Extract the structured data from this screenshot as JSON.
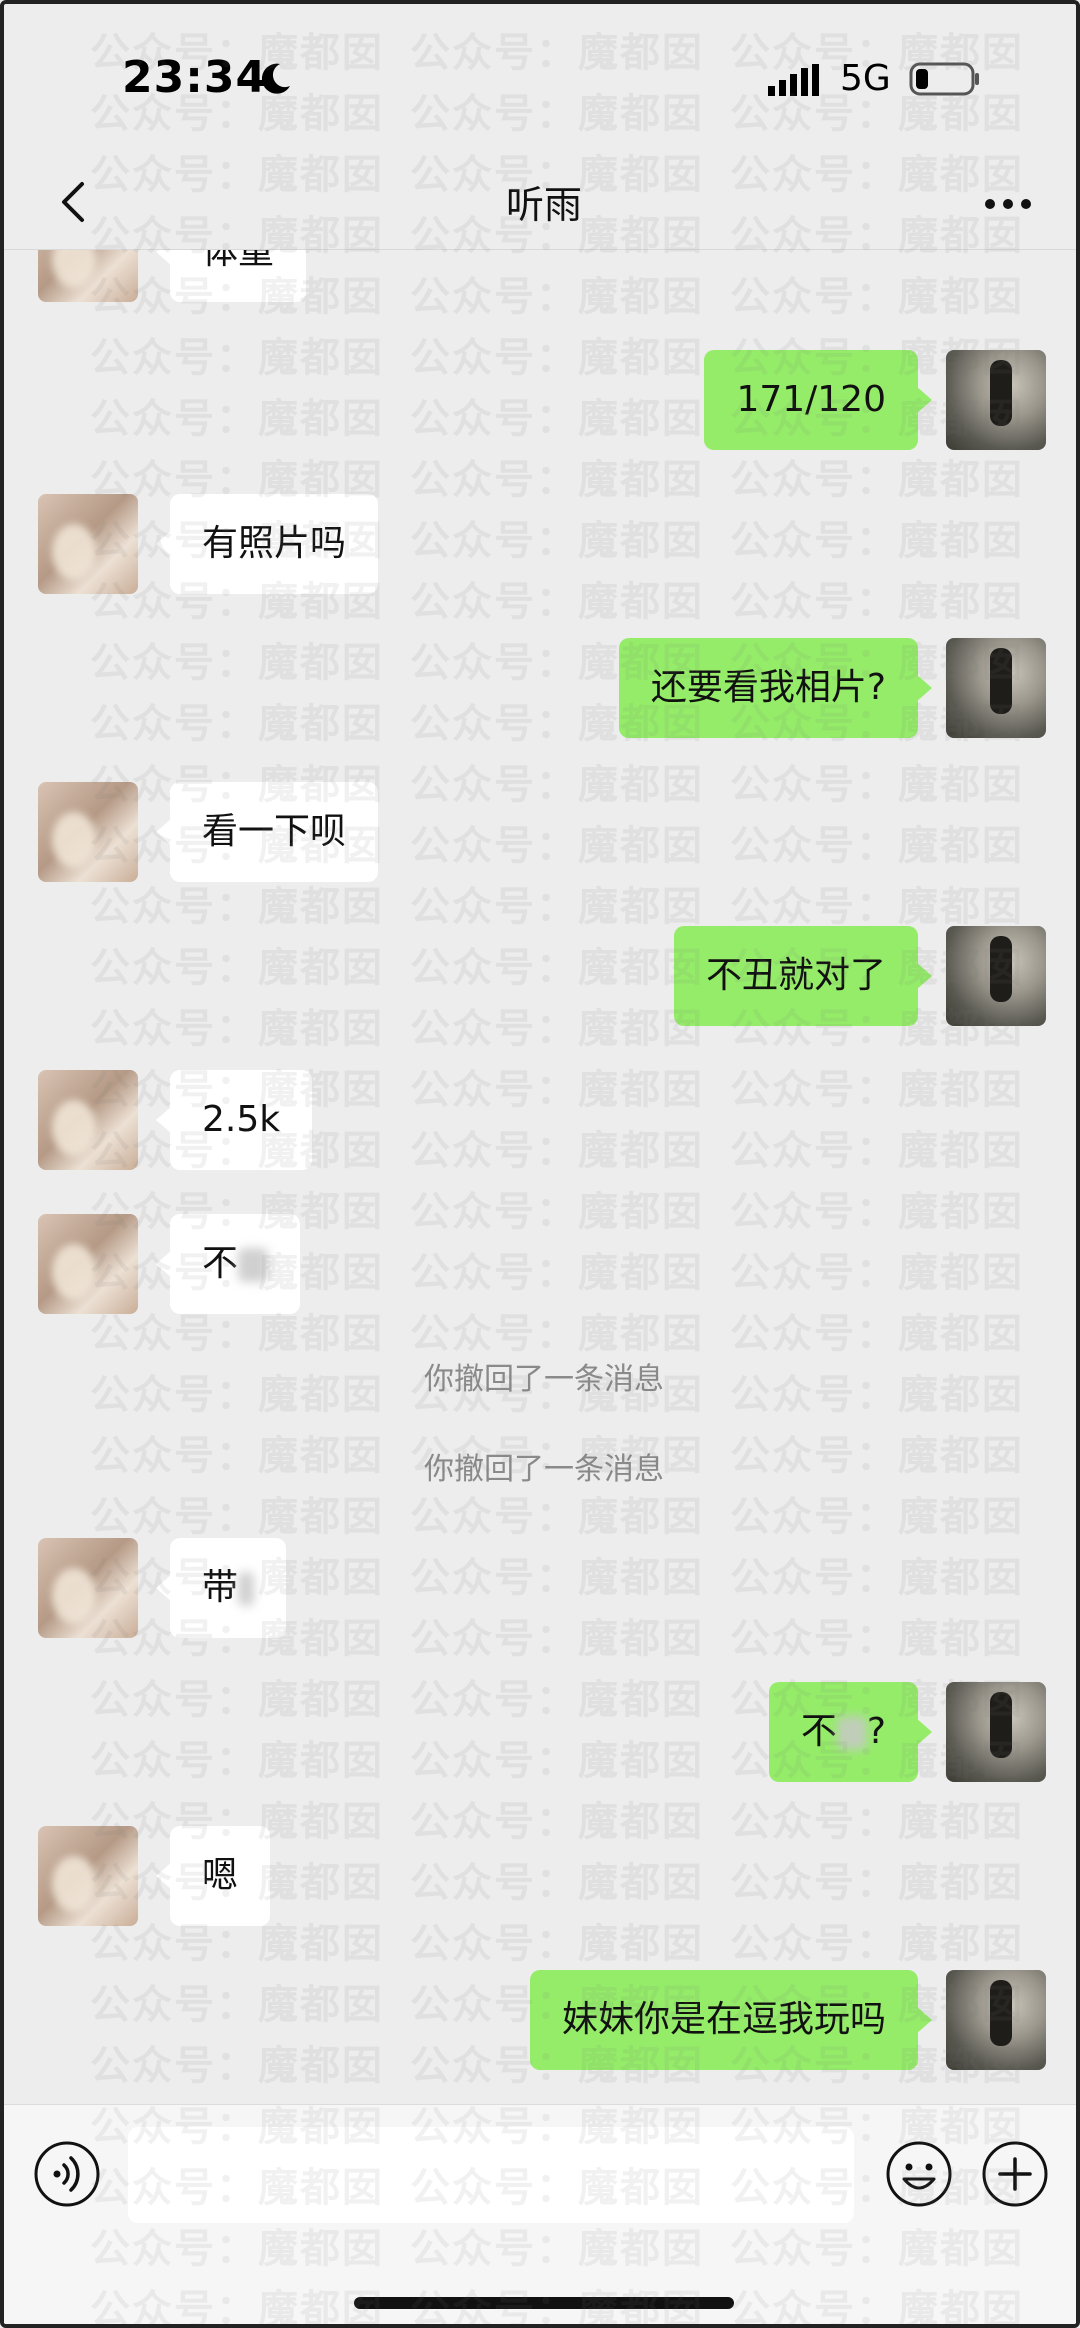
{
  "status_bar": {
    "time": "23:34",
    "network": "5G",
    "icons": [
      "moon-icon",
      "signal-icon",
      "battery-icon"
    ]
  },
  "nav": {
    "title": "听雨",
    "back_icon": "chevron-left-icon",
    "more_icon": "more-dots-icon"
  },
  "watermark": "公众号：魔都囡",
  "messages": [
    {
      "side": "left",
      "text": "体重",
      "partial": true
    },
    {
      "side": "right",
      "text": "171/120"
    },
    {
      "side": "left",
      "text": "有照片吗"
    },
    {
      "side": "right",
      "text": "还要看我相片?"
    },
    {
      "side": "left",
      "text": "看一下呗"
    },
    {
      "side": "right",
      "text": "不丑就对了"
    },
    {
      "side": "left",
      "text": "2.5k"
    },
    {
      "side": "left",
      "text": "不",
      "blurred_suffix": true
    },
    {
      "side": "system",
      "text": "你撤回了一条消息"
    },
    {
      "side": "system",
      "text": "你撤回了一条消息"
    },
    {
      "side": "left",
      "text": "带",
      "blurred_suffix": true
    },
    {
      "side": "right",
      "text": "不",
      "blurred_middle": true,
      "suffix": "?"
    },
    {
      "side": "left",
      "text": "嗯"
    },
    {
      "side": "right",
      "text": "妹妹你是在逗我玩吗"
    }
  ],
  "input_bar": {
    "voice_icon": "voice-icon",
    "emoji_icon": "emoji-icon",
    "plus_icon": "plus-icon",
    "input_value": ""
  },
  "colors": {
    "background": "#ededed",
    "sent_bubble": "#95ec69",
    "received_bubble": "#ffffff",
    "system_text": "#8a8a8a"
  }
}
